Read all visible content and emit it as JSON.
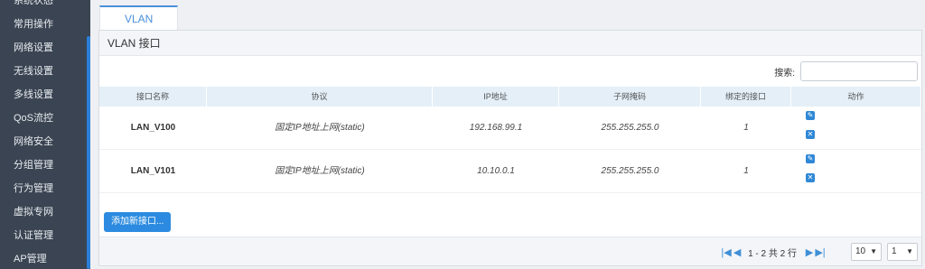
{
  "sidebar": {
    "items": [
      {
        "label": "系统状态"
      },
      {
        "label": "常用操作"
      },
      {
        "label": "网络设置"
      },
      {
        "label": "无线设置"
      },
      {
        "label": "多线设置"
      },
      {
        "label": "QoS流控"
      },
      {
        "label": "网络安全"
      },
      {
        "label": "分组管理"
      },
      {
        "label": "行为管理"
      },
      {
        "label": "虚拟专网"
      },
      {
        "label": "认证管理"
      },
      {
        "label": "AP管理"
      }
    ]
  },
  "tab": {
    "label": "VLAN"
  },
  "panel": {
    "title": "VLAN 接口"
  },
  "search": {
    "label": "搜索:",
    "value": ""
  },
  "table": {
    "headers": [
      "接口名称",
      "协议",
      "IP地址",
      "子网掩码",
      "绑定的接口",
      "动作"
    ],
    "rows": [
      {
        "name": "LAN_V100",
        "protocol": "固定IP地址上网(static)",
        "ip": "192.168.99.1",
        "mask": "255.255.255.0",
        "bound": "1"
      },
      {
        "name": "LAN_V101",
        "protocol": "固定IP地址上网(static)",
        "ip": "10.10.0.1",
        "mask": "255.255.255.0",
        "bound": "1"
      }
    ]
  },
  "add_button": {
    "label": "添加新接口..."
  },
  "pager": {
    "summary": "1 - 2 共 2 行",
    "page_size": "10",
    "page": "1"
  },
  "colors": {
    "sidebar": "#3a4452",
    "accent": "#2c8be0",
    "header_row": "#e4eff8"
  }
}
